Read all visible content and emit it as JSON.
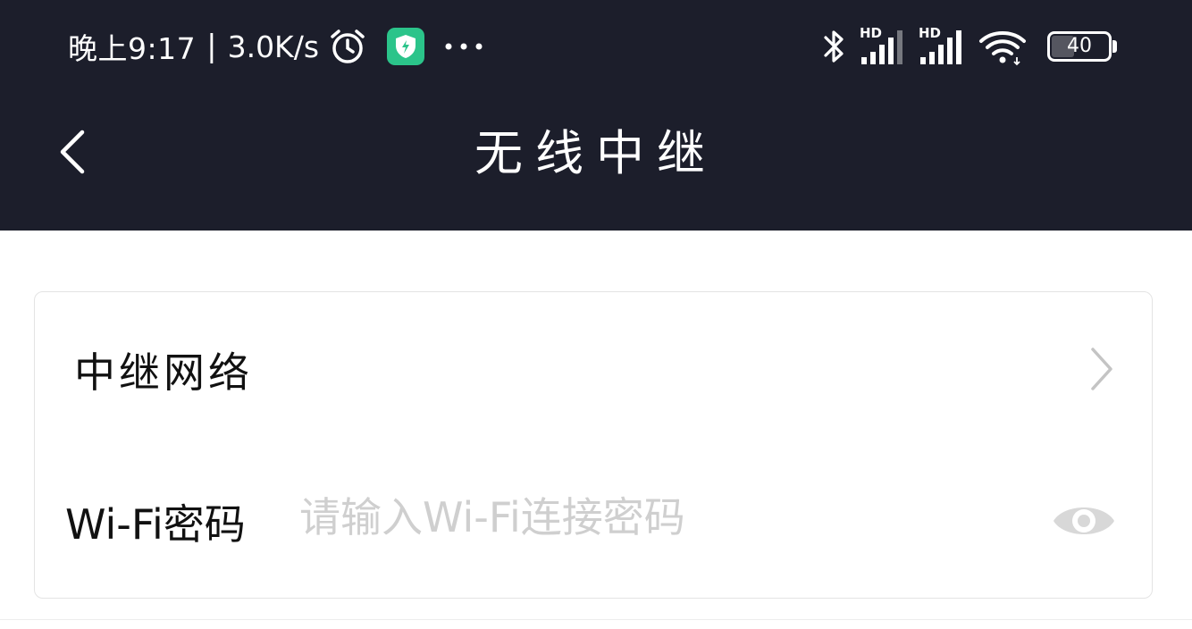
{
  "status_bar": {
    "time": "晚上9:17",
    "separator": "|",
    "net_speed": "3.0K/s",
    "icons": [
      "alarm-clock-icon",
      "security-shield-icon",
      "more-dots-icon",
      "bluetooth-icon",
      "signal-hd-icon",
      "signal-hd-icon",
      "wifi-icon",
      "battery-icon"
    ],
    "sim1_label": "HD",
    "sim2_label": "HD",
    "battery_level": "40",
    "colors": {
      "background": "#1c1e2b",
      "shield": "#2bc48a"
    }
  },
  "title_bar": {
    "title": "无线中继",
    "back_icon": "back-chevron-icon"
  },
  "settings": {
    "relay_network": {
      "label": "中继网络",
      "icon": "chevron-right-icon"
    },
    "wifi_password": {
      "label": "Wi-Fi密码",
      "value": "",
      "placeholder": "请输入Wi-Fi连接密码",
      "icon": "eye-icon"
    }
  }
}
